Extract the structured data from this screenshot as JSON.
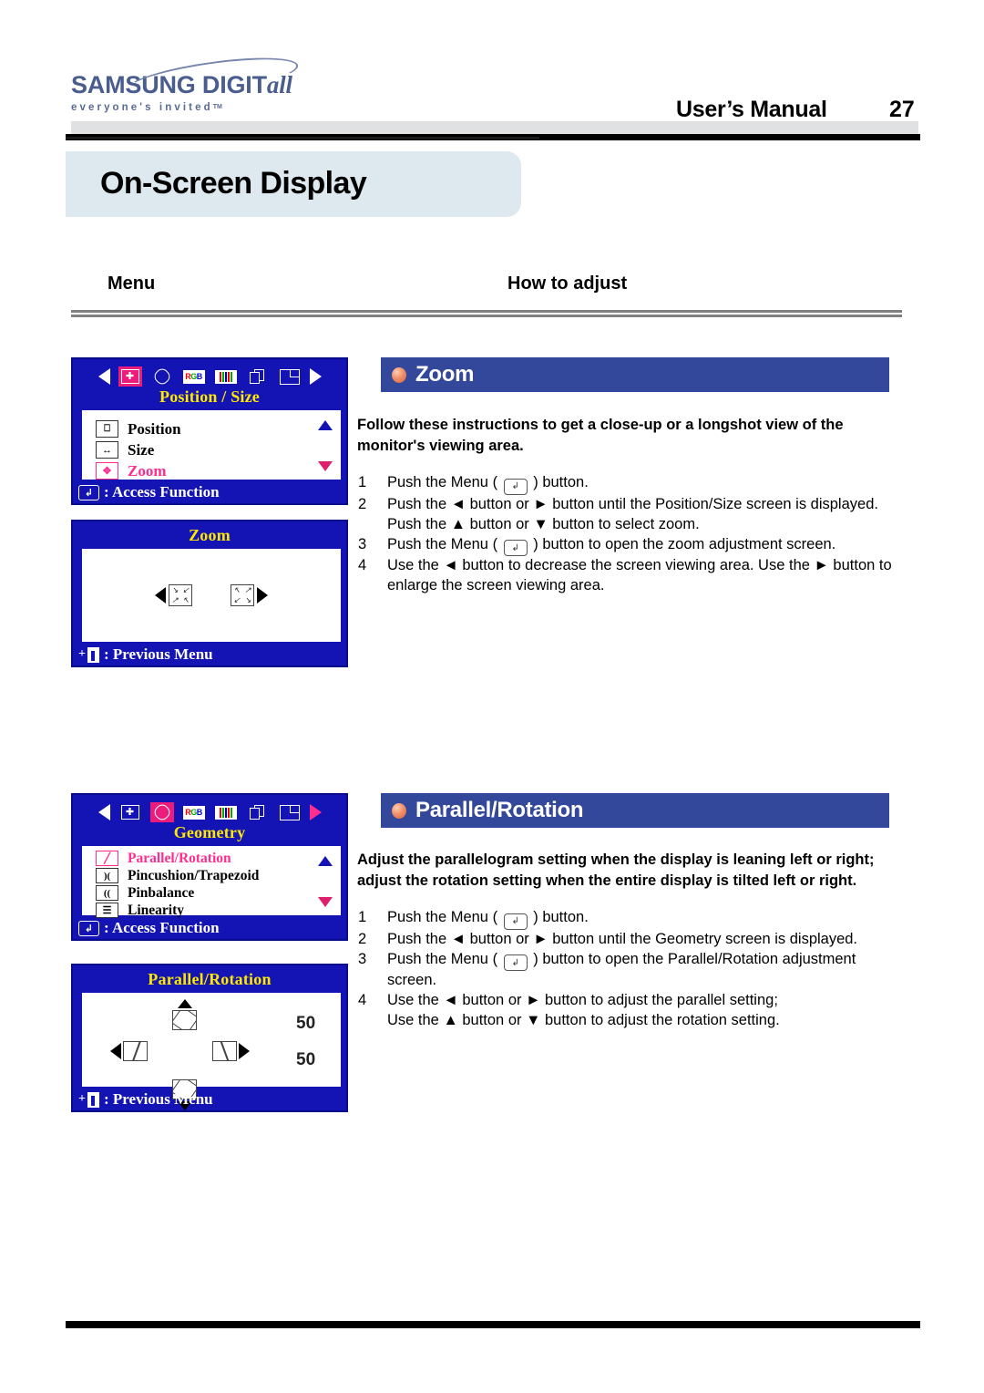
{
  "header": {
    "logo_main": "SAMSUNG DIGIT",
    "logo_main_italic": "all",
    "logo_sub": "everyone's invited",
    "logo_tm": "TM",
    "manual_title": "User’s Manual",
    "page_number": "27"
  },
  "page_title": "On-Screen Display",
  "columns": {
    "menu": "Menu",
    "how_to_adjust": "How to adjust"
  },
  "colors": {
    "osd_blue": "#1414b4",
    "section_bar_blue": "#33479b",
    "title_banner": "#dde8ef",
    "highlight_pink": "#ff2d8f",
    "osd_heading_yellow": "#ffe800",
    "bullet_orange": "#f0906a"
  },
  "sections": [
    {
      "id": "zoom",
      "bar_title": "Zoom",
      "intro": "Follow these instructions to get a close-up or a longshot view of the monitor's viewing area.",
      "steps": [
        {
          "num": "1",
          "pre": "Push the Menu ( ",
          "key": "↲",
          "post": " ) button.",
          "cont": ""
        },
        {
          "num": "2",
          "pre": "Push the ◄ button or ► button until the Position/Size screen is displayed.",
          "key": "",
          "post": "",
          "cont": "Push the ▲ button or ▼ button to select zoom."
        },
        {
          "num": "3",
          "pre": "Push the Menu ( ",
          "key": "↲",
          "post": " ) button to open the zoom adjustment screen.",
          "cont": ""
        },
        {
          "num": "4",
          "pre": "Use the ◄ button to decrease the screen viewing area. Use the ► button to",
          "key": "",
          "post": "",
          "cont": "enlarge the screen viewing area."
        }
      ],
      "menu_osd": {
        "heading": "Position / Size",
        "footer_label": ": Access Function",
        "footer_key": "↲",
        "items": [
          {
            "label": "Position",
            "icon": "position-icon",
            "selected": false
          },
          {
            "label": "Size",
            "icon": "size-icon",
            "selected": false
          },
          {
            "label": "Zoom",
            "icon": "zoom-icon",
            "selected": true
          }
        ],
        "toolbar_icons": [
          "position-size-icon",
          "geometry-icon",
          "rgb-icon",
          "color-bars-icon",
          "osd-stack-icon",
          "corner-icon"
        ],
        "selected_toolbar_index": 0
      },
      "adjust_osd": {
        "heading": "Zoom",
        "footer_label": ": Previous Menu",
        "controls": [
          "zoom-out-control",
          "zoom-in-control"
        ]
      }
    },
    {
      "id": "parallel-rotation",
      "bar_title": "Parallel/Rotation",
      "intro": "Adjust the parallelogram setting when the display is leaning left or right; adjust the rotation setting when the entire display is tilted left or right.",
      "steps": [
        {
          "num": "1",
          "pre": "Push the Menu ( ",
          "key": "↲",
          "post": " ) button.",
          "cont": ""
        },
        {
          "num": "2",
          "pre": "Push the ◄ button or ► button until the  Geometry screen is displayed.",
          "key": "",
          "post": "",
          "cont": ""
        },
        {
          "num": "3",
          "pre": "Push the Menu ( ",
          "key": "↲",
          "post": " ) button to open the Parallel/Rotation adjustment",
          "cont": "screen."
        },
        {
          "num": "4",
          "pre": "Use the ◄ button or ► button to adjust the parallel setting;",
          "key": "",
          "post": "",
          "cont": "Use the ▲ button or ▼ button to adjust the rotation setting."
        }
      ],
      "menu_osd": {
        "heading": "Geometry",
        "footer_label": ": Access Function",
        "footer_key": "↲",
        "items": [
          {
            "label": "Parallel/Rotation",
            "icon": "parallel-rotation-icon",
            "selected": true
          },
          {
            "label": "Pincushion/Trapezoid",
            "icon": "pincushion-icon",
            "selected": false
          },
          {
            "label": "Pinbalance",
            "icon": "pinbalance-icon",
            "selected": false
          },
          {
            "label": "Linearity",
            "icon": "linearity-icon",
            "selected": false
          }
        ],
        "toolbar_icons": [
          "position-size-icon",
          "geometry-icon",
          "rgb-icon",
          "color-bars-icon",
          "osd-stack-icon",
          "corner-icon"
        ],
        "selected_toolbar_index": 1
      },
      "adjust_osd": {
        "heading": "Parallel/Rotation",
        "footer_label": ": Previous Menu",
        "value_rotation": "50",
        "value_parallel": "50"
      }
    }
  ],
  "rgb_icon_text": {
    "r": "R",
    "g": "G",
    "b": "B"
  }
}
